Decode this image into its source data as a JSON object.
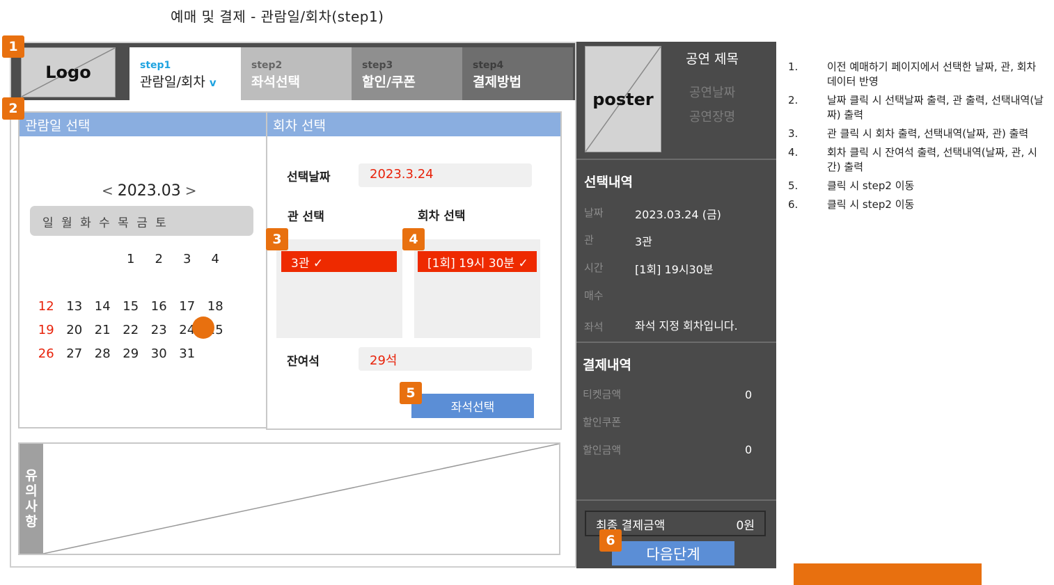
{
  "doc_title": "예매 및 결제 - 관람일/회차(step1)",
  "logo_text": "Logo",
  "tabs": [
    {
      "step": "step1",
      "label": "관람일/회차",
      "chevron": "v"
    },
    {
      "step": "step2",
      "label": "좌석선택"
    },
    {
      "step": "step3",
      "label": "할인/쿠폰"
    },
    {
      "step": "step4",
      "label": "결제방법"
    }
  ],
  "badges": [
    "1",
    "2",
    "3",
    "4",
    "5",
    "6"
  ],
  "calendar": {
    "header": "관람일 선택",
    "prev_arrow": "<",
    "month": "2023.03",
    "next_arrow": ">",
    "weekdays": "일 월 화 수 목 금 토",
    "rows": [
      [
        "",
        "",
        "",
        "1",
        "2",
        "3",
        "4"
      ],
      [
        "12",
        "13",
        "14",
        "15",
        "16",
        "17",
        "18"
      ],
      [
        "19",
        "20",
        "21",
        "22",
        "23",
        "24",
        "25"
      ],
      [
        "26",
        "27",
        "28",
        "29",
        "30",
        "31",
        ""
      ]
    ],
    "selected_day": "24"
  },
  "session": {
    "header": "회차 선택",
    "date_label": "선택날짜",
    "date_value": "2023.3.24",
    "hall_label": "관 선택",
    "round_label": "회차 선택",
    "hall_selected": "3관 ✓",
    "round_selected": "[1회] 19시 30분 ✓",
    "remaining_label": "잔여석",
    "remaining_value": "29석",
    "seat_button": "좌석선택"
  },
  "notes_side_label": [
    "유",
    "의",
    "사",
    "항"
  ],
  "sidebar": {
    "poster_text": "poster",
    "show_title": "공연 제목",
    "show_date": "공연날짜",
    "show_venue": "공연장명",
    "selection_title": "선택내역",
    "selection": [
      {
        "key": "날짜",
        "value": "2023.03.24 (금)"
      },
      {
        "key": "관",
        "value": "3관"
      },
      {
        "key": "시간",
        "value": "[1회] 19시30분"
      },
      {
        "key": "매수",
        "value": ""
      },
      {
        "key": "좌석",
        "value": "좌석 지정 회차입니다."
      }
    ],
    "payment_title": "결제내역",
    "payment": [
      {
        "key": "티켓금액",
        "value": "0"
      },
      {
        "key": "할인쿠폰",
        "value": ""
      },
      {
        "key": "할인금액",
        "value": "0"
      }
    ],
    "total_label": "최종 결제금액",
    "total_value": "0원",
    "next_button": "다음단계"
  },
  "notes": [
    {
      "num": "1.",
      "text": "이전 예매하기 페이지에서 선택한 날짜, 관, 회차 데이터 반영"
    },
    {
      "num": "2.",
      "text": "날짜 클릭 시 선택날짜 출력, 관 출력, 선택내역(날짜) 출력"
    },
    {
      "num": "3.",
      "text": "관 클릭 시 회차 출력, 선택내역(날짜, 관) 출력"
    },
    {
      "num": "4.",
      "text": "회차 클릭 시 잔여석 출력, 선택내역(날짜, 관, 시간) 출력"
    },
    {
      "num": "5.",
      "text": "클릭 시 step2 이동"
    },
    {
      "num": "6.",
      "text": "클릭 시 step2 이동"
    }
  ],
  "colors": {
    "accent_orange": "#e8700f",
    "selected_red": "#ee2a00",
    "button_blue": "#5b8ed6",
    "panel_header_blue": "#8aaee0",
    "sunday_red": "#e8220a",
    "step_active_blue": "#1fa3e0",
    "sidebar_dark": "#4a4a4a"
  }
}
